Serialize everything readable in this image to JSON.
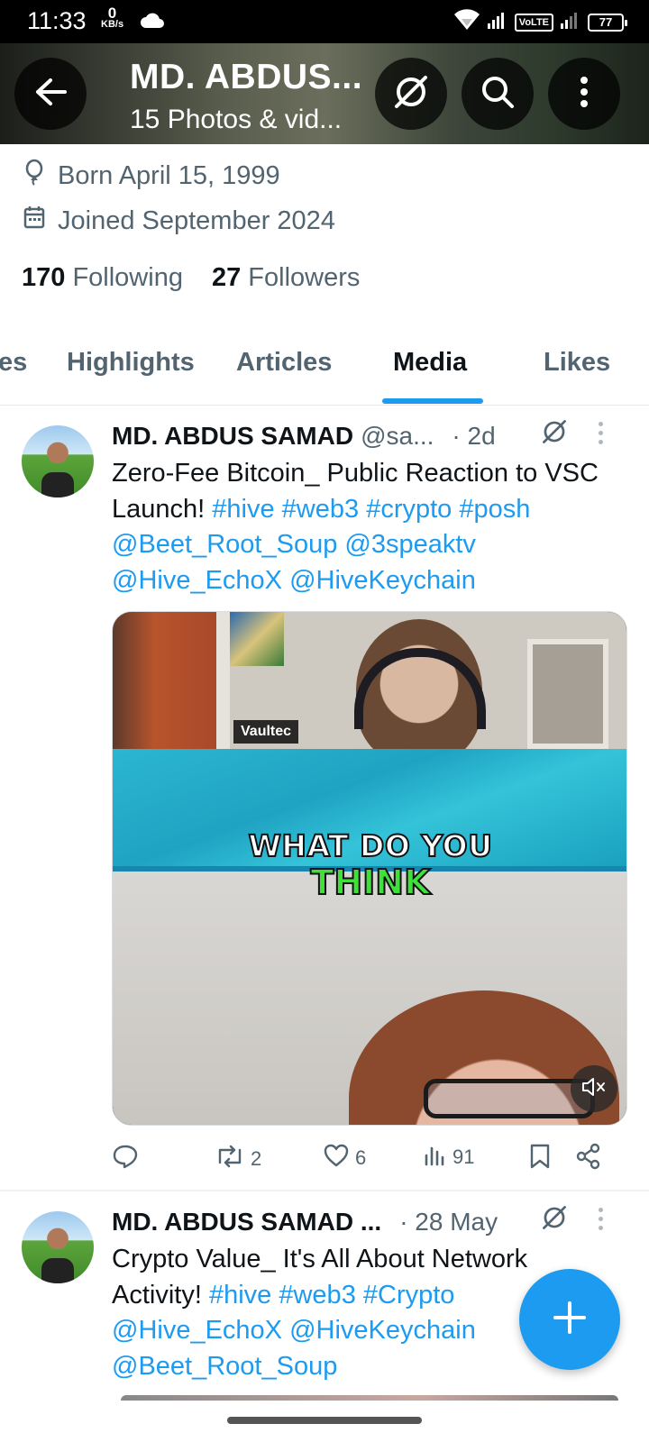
{
  "status_bar": {
    "time": "11:33",
    "speed_value": "0",
    "speed_unit": "KB/s",
    "network_badge": "VoLTE",
    "battery": "77"
  },
  "header": {
    "title": "MD. ABDUS...",
    "subtitle": "15 Photos & vid...",
    "icons": [
      "back-arrow-icon",
      "grok-icon",
      "search-icon",
      "more-vertical-icon"
    ]
  },
  "profile": {
    "born": "Born April 15, 1999",
    "joined": "Joined September 2024",
    "following_count": "170",
    "following_label": "Following",
    "followers_count": "27",
    "followers_label": "Followers"
  },
  "tabs": [
    {
      "label": "es",
      "active": false
    },
    {
      "label": "Highlights",
      "active": false
    },
    {
      "label": "Articles",
      "active": false
    },
    {
      "label": "Media",
      "active": true
    },
    {
      "label": "Likes",
      "active": false
    }
  ],
  "posts": [
    {
      "name": "MD. ABDUS SAMAD",
      "handle": "@sa...",
      "time": "· 2d",
      "text_plain_1": "Zero-Fee Bitcoin_ Public Reaction to VSC Launch!",
      "tags": [
        "#hive",
        "#web3",
        "#crypto",
        "#posh"
      ],
      "mentions": [
        "@Beet_Root_Soup",
        "@3speaktv",
        "@Hive_EchoX",
        "@HiveKeychain"
      ],
      "media": {
        "top_label": "Vaultec",
        "caption_line1": "WHAT DO YOU",
        "caption_line2": "THINK"
      },
      "actions": {
        "reply": "",
        "reposts": "2",
        "likes": "6",
        "views": "91"
      }
    },
    {
      "name": "MD. ABDUS SAMAD ...",
      "handle": "",
      "time": "· 28 May",
      "text_plain_1": "Crypto Value_ It's All About Network Activity!",
      "tags": [
        "#hive",
        "#web3",
        "#Crypto"
      ],
      "mentions": [
        "@Hive_EchoX",
        "@HiveKeychain",
        "@Beet_Root_Soup"
      ]
    }
  ],
  "colors": {
    "accent": "#1d9bf0",
    "text_primary": "#0f1419",
    "text_secondary": "#536471"
  }
}
